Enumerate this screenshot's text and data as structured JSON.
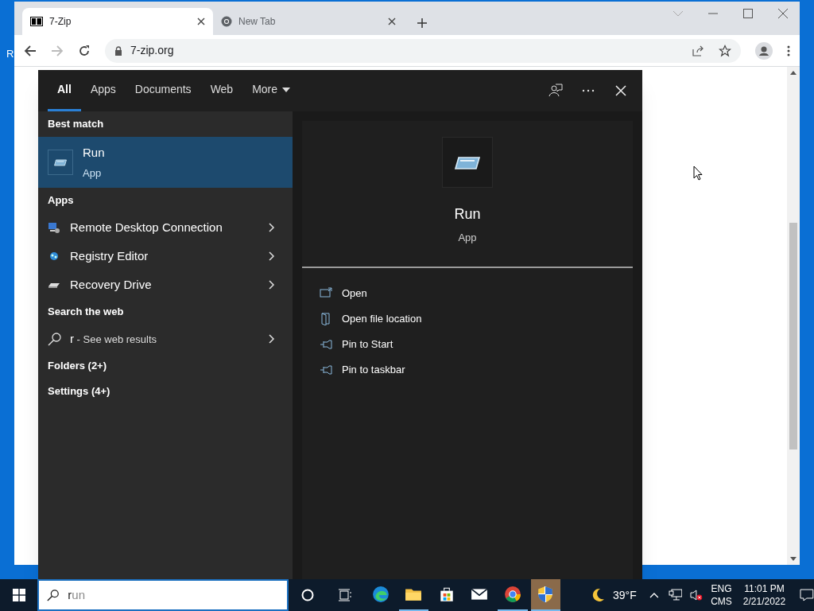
{
  "desktop": {
    "icon_label": "R"
  },
  "browser": {
    "tabs": [
      {
        "title": "7-Zip",
        "selected": true,
        "kind": "sevenzip"
      },
      {
        "title": "New Tab",
        "selected": false,
        "kind": "chrome"
      }
    ],
    "address": "7-zip.org"
  },
  "start_menu": {
    "filters": [
      {
        "label": "All",
        "selected": true
      },
      {
        "label": "Apps",
        "selected": false
      },
      {
        "label": "Documents",
        "selected": false
      },
      {
        "label": "Web",
        "selected": false
      },
      {
        "label": "More",
        "selected": false
      }
    ],
    "best_match": {
      "heading": "Best match",
      "title": "Run",
      "subtitle": "App",
      "selected": true
    },
    "apps": {
      "heading": "Apps",
      "items": [
        {
          "label": "Remote Desktop Connection",
          "kind": "remote"
        },
        {
          "label": "Registry Editor",
          "kind": "registry"
        },
        {
          "label": "Recovery Drive",
          "kind": "drive"
        }
      ]
    },
    "web": {
      "heading": "Search the web",
      "text": "**r** - See web results"
    },
    "groups": [
      "Folders (2+)",
      "Settings (4+)"
    ],
    "detail": {
      "title": "Run",
      "subtitle": "App",
      "actions": [
        {
          "label": "Open",
          "kind": "open"
        },
        {
          "label": "Open file location",
          "kind": "folder"
        },
        {
          "label": "Pin to Start",
          "kind": "pin"
        },
        {
          "label": "Pin to taskbar",
          "kind": "pin"
        }
      ]
    }
  },
  "taskbar": {
    "search": {
      "typed": "r",
      "suggestion": "un"
    },
    "apps": [
      {
        "kind": "edge",
        "open": false,
        "selected": false
      },
      {
        "kind": "explorer",
        "open": true,
        "selected": false
      },
      {
        "kind": "store",
        "open": false,
        "selected": false
      },
      {
        "kind": "mail",
        "open": false,
        "selected": false
      },
      {
        "kind": "chrome",
        "open": true,
        "selected": false
      },
      {
        "kind": "shield",
        "open": true,
        "selected": true
      }
    ],
    "weather": "39°F",
    "language": "ENG",
    "layout": "CMS",
    "time": "11:01 PM",
    "date": "2/21/2022"
  }
}
